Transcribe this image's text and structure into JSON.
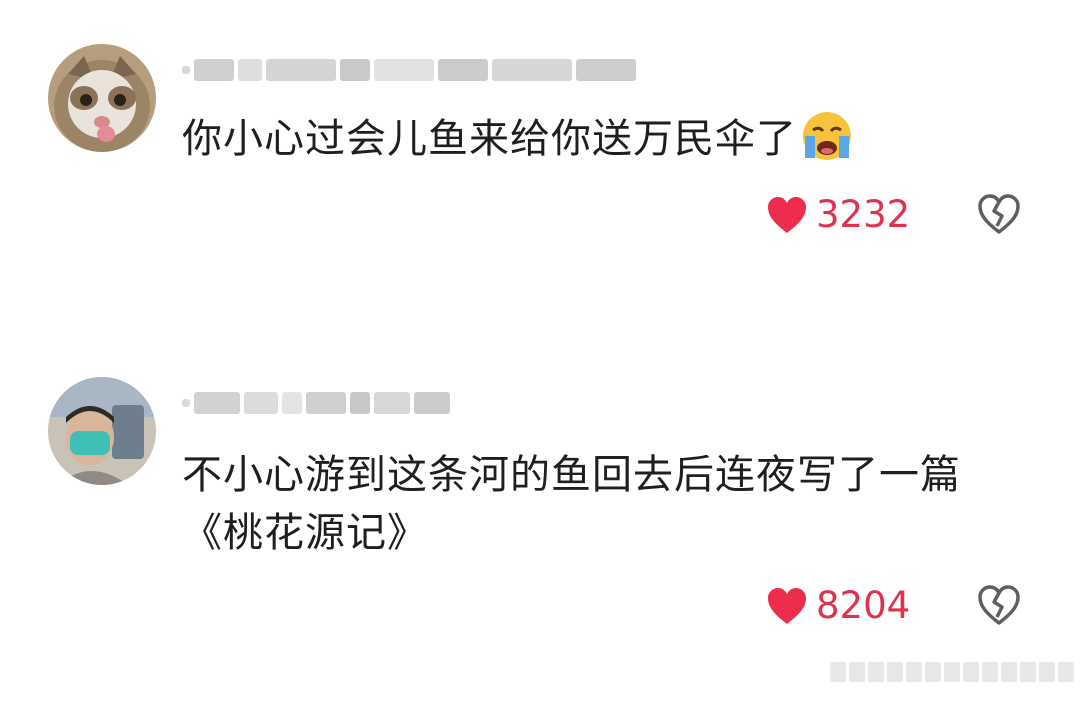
{
  "comments": [
    {
      "text": "你小心过会儿鱼来给你送万民伞了",
      "emoji": "loudly-crying-face",
      "likes": "3232"
    },
    {
      "text": "不小心游到这条河的鱼回去后连夜写了一篇《桃花源记》",
      "likes": "8204"
    }
  ],
  "colors": {
    "heart": "#ec2d4b",
    "like_count": "#e0324f",
    "text": "#1f1f1f",
    "dislike_icon": "#5f5f5f"
  },
  "icons": [
    "heart-icon",
    "broken-heart-icon",
    "loudly-crying-face-emoji"
  ]
}
